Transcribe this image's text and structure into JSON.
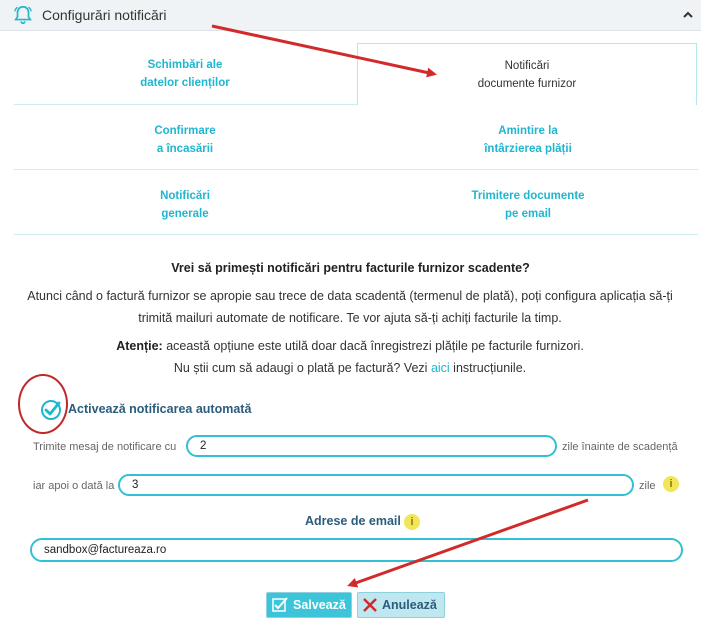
{
  "header": {
    "title": "Configurări notificări",
    "collapse_icon": "chevron-up-icon",
    "bell_icon": "bell-icon"
  },
  "tabs": [
    {
      "line1": "Schimbări ale",
      "line2": "datelor clienților",
      "active": false
    },
    {
      "line1": "Notificări",
      "line2": "documente furnizor",
      "active": true
    },
    {
      "line1": "Confirmare",
      "line2": "a încasării",
      "active": false
    },
    {
      "line1": "Amintire la",
      "line2": "întârzierea plății",
      "active": false
    },
    {
      "line1": "Notificări",
      "line2": "generale",
      "active": false
    },
    {
      "line1": "Trimitere documente",
      "line2": "pe email",
      "active": false
    }
  ],
  "content": {
    "question": "Vrei să primești notificări pentru facturile furnizor scadente?",
    "desc_line1": "Atunci când o factură furnizor se apropie sau trece de data scadentă (termenul de plată), poți configura aplicația să-ți",
    "desc_line2": "trimită mailuri automate de notificare. Te vor ajuta să-ți achiți facturile la timp.",
    "attention_label": "Atenție:",
    "attention_text": " această opțiune este utilă doar dacă înregistrezi plățile pe facturile furnizori.",
    "help_prefix": "Nu știi cum să adaugi o plată pe factură? Vezi ",
    "help_link": "aici",
    "help_suffix": " instrucțiunile."
  },
  "form": {
    "activate_label": "Activează notificarea automată",
    "activate_checked": true,
    "send_label": "Trimite mesaj de notificare cu",
    "days_before": "2",
    "days_before_suffix": "zile înainte de scadență",
    "then_label": "iar apoi o dată la",
    "interval_days": "3",
    "interval_suffix": "zile",
    "email_section_title": "Adrese de email",
    "email": "sandbox@factureaza.ro"
  },
  "buttons": {
    "save": "Salvează",
    "cancel": "Anulează"
  },
  "colors": {
    "accent": "#1fb6cf",
    "input_border": "#33c0d4",
    "annotation_red": "#d22a2a",
    "info_yellow": "#f1e55a"
  }
}
